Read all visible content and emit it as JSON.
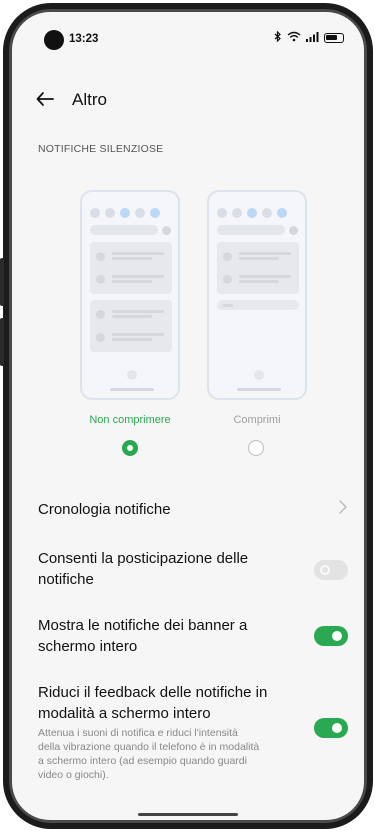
{
  "status": {
    "time": "13:23",
    "icons": [
      "bluetooth-icon",
      "wifi-icon",
      "signal-icon",
      "battery-icon"
    ]
  },
  "header": {
    "back_icon": "arrow-left-icon",
    "title": "Altro"
  },
  "section": {
    "label": "NOTIFICHE SILENZIOSE"
  },
  "options": [
    {
      "label": "Non comprimere",
      "selected": true,
      "color": "#29a952"
    },
    {
      "label": "Comprimi",
      "selected": false,
      "color": "#9e9e9e"
    }
  ],
  "settings": {
    "history": {
      "label": "Cronologia notifiche",
      "icon": "chevron-right-icon"
    },
    "snooze": {
      "label_line1": "Consenti la posticipazione delle",
      "label_line2": "notifiche",
      "enabled": false
    },
    "banners": {
      "label_line1": "Mostra le notifiche dei banner a",
      "label_line2": "schermo intero",
      "enabled": true
    },
    "feedback": {
      "label_line1": "Riduci il feedback delle notifiche in",
      "label_line2": "modalità a schermo intero",
      "sub_line1": "Attenua i suoni di notifica e riduci l'intensità",
      "sub_line2": "della vibrazione quando il telefono è in modalità",
      "sub_line3": "a schermo intero (ad esempio quando guardi",
      "sub_line4": "video o giochi).",
      "enabled": true
    }
  },
  "colors": {
    "accent": "#29a952",
    "background": "#f6f6f6",
    "toggle_off": "#e3e3e3"
  }
}
